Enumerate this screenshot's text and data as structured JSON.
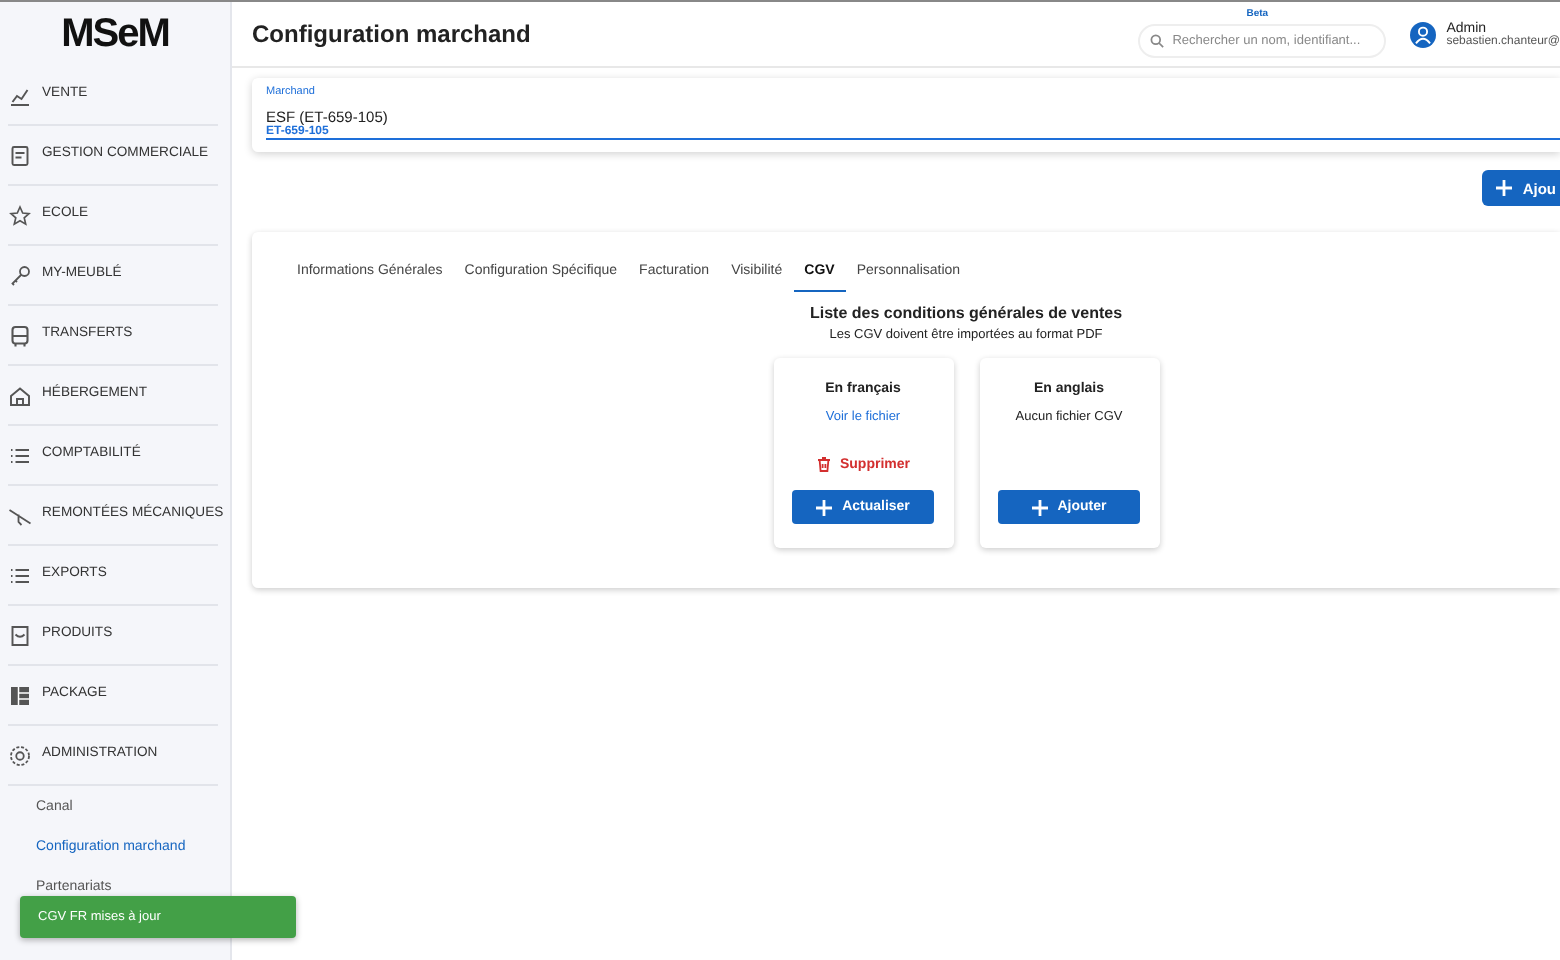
{
  "logo": {
    "text": "MSeM"
  },
  "sidebar": {
    "items": [
      {
        "label": "VENTE"
      },
      {
        "label": "GESTION COMMERCIALE"
      },
      {
        "label": "ECOLE"
      },
      {
        "label": "MY-MEUBLÉ"
      },
      {
        "label": "TRANSFERTS"
      },
      {
        "label": "HÉBERGEMENT"
      },
      {
        "label": "COMPTABILITÉ"
      },
      {
        "label": "REMONTÉES MÉCANIQUES"
      },
      {
        "label": "EXPORTS"
      },
      {
        "label": "PRODUITS"
      },
      {
        "label": "PACKAGE"
      },
      {
        "label": "ADMINISTRATION",
        "children": [
          {
            "label": "Canal",
            "selected": false
          },
          {
            "label": "Configuration marchand",
            "selected": true
          },
          {
            "label": "Partenariats",
            "selected": false
          }
        ]
      }
    ]
  },
  "header": {
    "title": "Configuration marchand",
    "search": {
      "badge": "Beta",
      "placeholder": "Rechercher un nom, identifiant..."
    },
    "user": {
      "name": "Admin",
      "email": "sebastien.chanteur@"
    }
  },
  "merchant_field": {
    "label": "Marchand",
    "value": "ESF (ET-659-105)",
    "code": "ET-659-105"
  },
  "add_button": {
    "label": "Ajou"
  },
  "tabs": [
    {
      "label": "Informations Générales",
      "selected": false
    },
    {
      "label": "Configuration Spécifique",
      "selected": false
    },
    {
      "label": "Facturation",
      "selected": false
    },
    {
      "label": "Visibilité",
      "selected": false
    },
    {
      "label": "CGV",
      "selected": true
    },
    {
      "label": "Personnalisation",
      "selected": false
    }
  ],
  "cgv": {
    "title": "Liste des conditions générales de ventes",
    "subtitle": "Les CGV doivent être importées au format PDF",
    "cards": [
      {
        "title": "En français",
        "kind": "file",
        "link": "Voir le fichier",
        "delete": "Supprimer",
        "button": "Actualiser"
      },
      {
        "title": "En anglais",
        "kind": "empty",
        "message": "Aucun fichier CGV",
        "button": "Ajouter"
      }
    ]
  },
  "toast": {
    "message": "CGV FR mises à jour"
  }
}
